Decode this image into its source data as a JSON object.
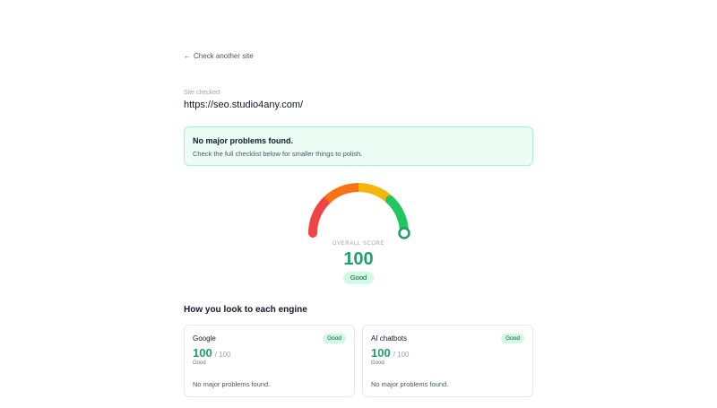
{
  "back_link": {
    "arrow": "←",
    "label": "Check another site"
  },
  "site": {
    "label": "Site checked",
    "url": "https://seo.studio4any.com/"
  },
  "notice": {
    "title": "No major problems found.",
    "text": "Check the full checklist below for smaller things to polish."
  },
  "gauge": {
    "label": "OVERALL SCORE",
    "score": "100",
    "score_value": 100,
    "score_max": 100,
    "rating": "Good",
    "colors": [
      "#ef4444",
      "#f97316",
      "#f5b50a",
      "#22c55e"
    ]
  },
  "section": {
    "title": "How you look to each engine"
  },
  "engines": [
    {
      "name": "Google",
      "badge": "Good",
      "score": "100",
      "max": "/ 100",
      "rating": "Good",
      "note": "No major problems found."
    },
    {
      "name": "AI chatbots",
      "badge": "Good",
      "score": "100",
      "max": "/ 100",
      "rating": "Good",
      "note": "No major problems found."
    }
  ],
  "colors": {
    "accent": "#22a06b",
    "notice_bg": "#ecfdf5",
    "badge_bg": "#d1fae5"
  }
}
